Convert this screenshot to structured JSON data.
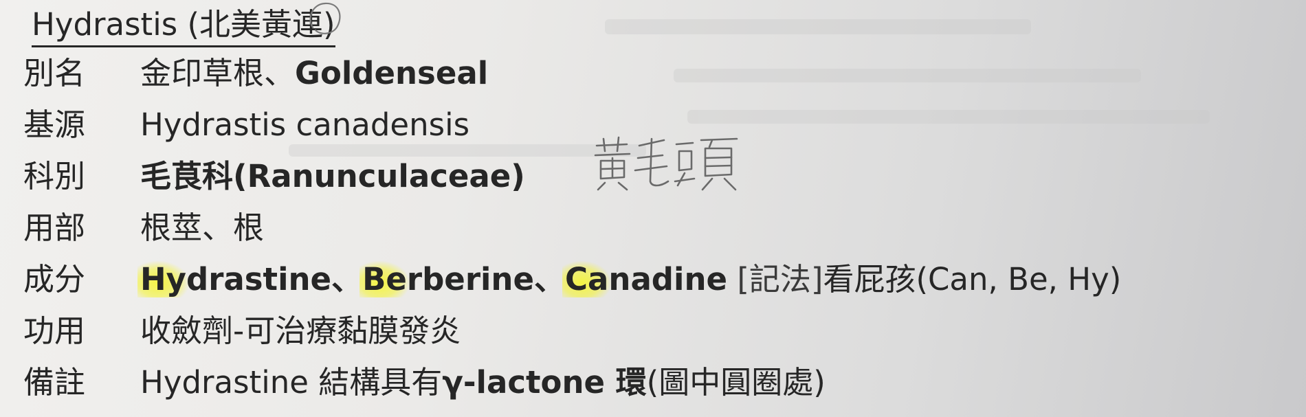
{
  "title": "Hydrastis (北美黃連)",
  "rows": [
    {
      "label": "別名",
      "parts": [
        {
          "text": "金印草根、"
        },
        {
          "text": "Goldenseal",
          "bold": true
        }
      ]
    },
    {
      "label": "基源",
      "parts": [
        {
          "text": "Hydrastis canadensis"
        }
      ]
    },
    {
      "label": "科別",
      "parts": [
        {
          "text": "毛茛科(Ranunculaceae)",
          "bold": true
        }
      ]
    },
    {
      "label": "用部",
      "parts": [
        {
          "text": "根莖、根"
        }
      ]
    },
    {
      "label": "成分",
      "parts": [
        {
          "text": "Hy",
          "bold": true,
          "highlight": true
        },
        {
          "text": "drastine、",
          "bold": true
        },
        {
          "text": "Be",
          "bold": true,
          "highlight": true
        },
        {
          "text": "rberine、",
          "bold": true
        },
        {
          "text": "Ca",
          "bold": true,
          "highlight": true
        },
        {
          "text": "nadine",
          "bold": true
        },
        {
          "text": " [記法]",
          "muted": true
        },
        {
          "text": "看屁孩(Can, Be, Hy)"
        }
      ]
    },
    {
      "label": "功用",
      "parts": [
        {
          "text": "收斂劑-可治療黏膜發炎"
        }
      ]
    },
    {
      "label": "備註",
      "parts": [
        {
          "text": "Hydrastine 結構具有"
        },
        {
          "text": "γ-lactone 環",
          "bold": true
        },
        {
          "text": "(圖中圓圈處)"
        }
      ]
    }
  ],
  "annotation": {
    "handwritten_note": "黃毛頭",
    "ink_color": "#6a6a6a"
  },
  "colors": {
    "paper": "#ebeae8",
    "text": "#262626",
    "highlighter": "#f5f528"
  }
}
